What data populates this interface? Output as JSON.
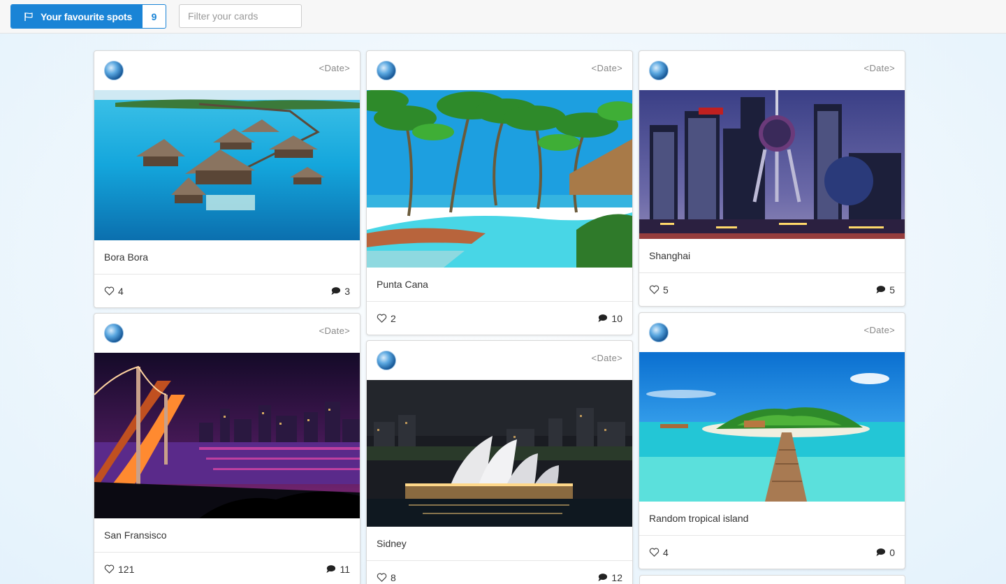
{
  "header": {
    "favourites_label": "Your favourite spots",
    "favourites_count": "9",
    "filter_placeholder": "Filter your cards"
  },
  "cards": [
    {
      "date": "<Date>",
      "title": "Bora Bora",
      "likes": "4",
      "comments": "3"
    },
    {
      "date": "<Date>",
      "title": "Punta Cana",
      "likes": "2",
      "comments": "10"
    },
    {
      "date": "<Date>",
      "title": "Shanghai",
      "likes": "5",
      "comments": "5"
    },
    {
      "date": "<Date>",
      "title": "San Fransisco",
      "likes": "121",
      "comments": "11"
    },
    {
      "date": "<Date>",
      "title": "Sidney",
      "likes": "8",
      "comments": "12"
    },
    {
      "date": "<Date>",
      "title": "Random tropical island",
      "likes": "4",
      "comments": "0"
    }
  ],
  "colors": {
    "accent": "#1a84d6"
  }
}
